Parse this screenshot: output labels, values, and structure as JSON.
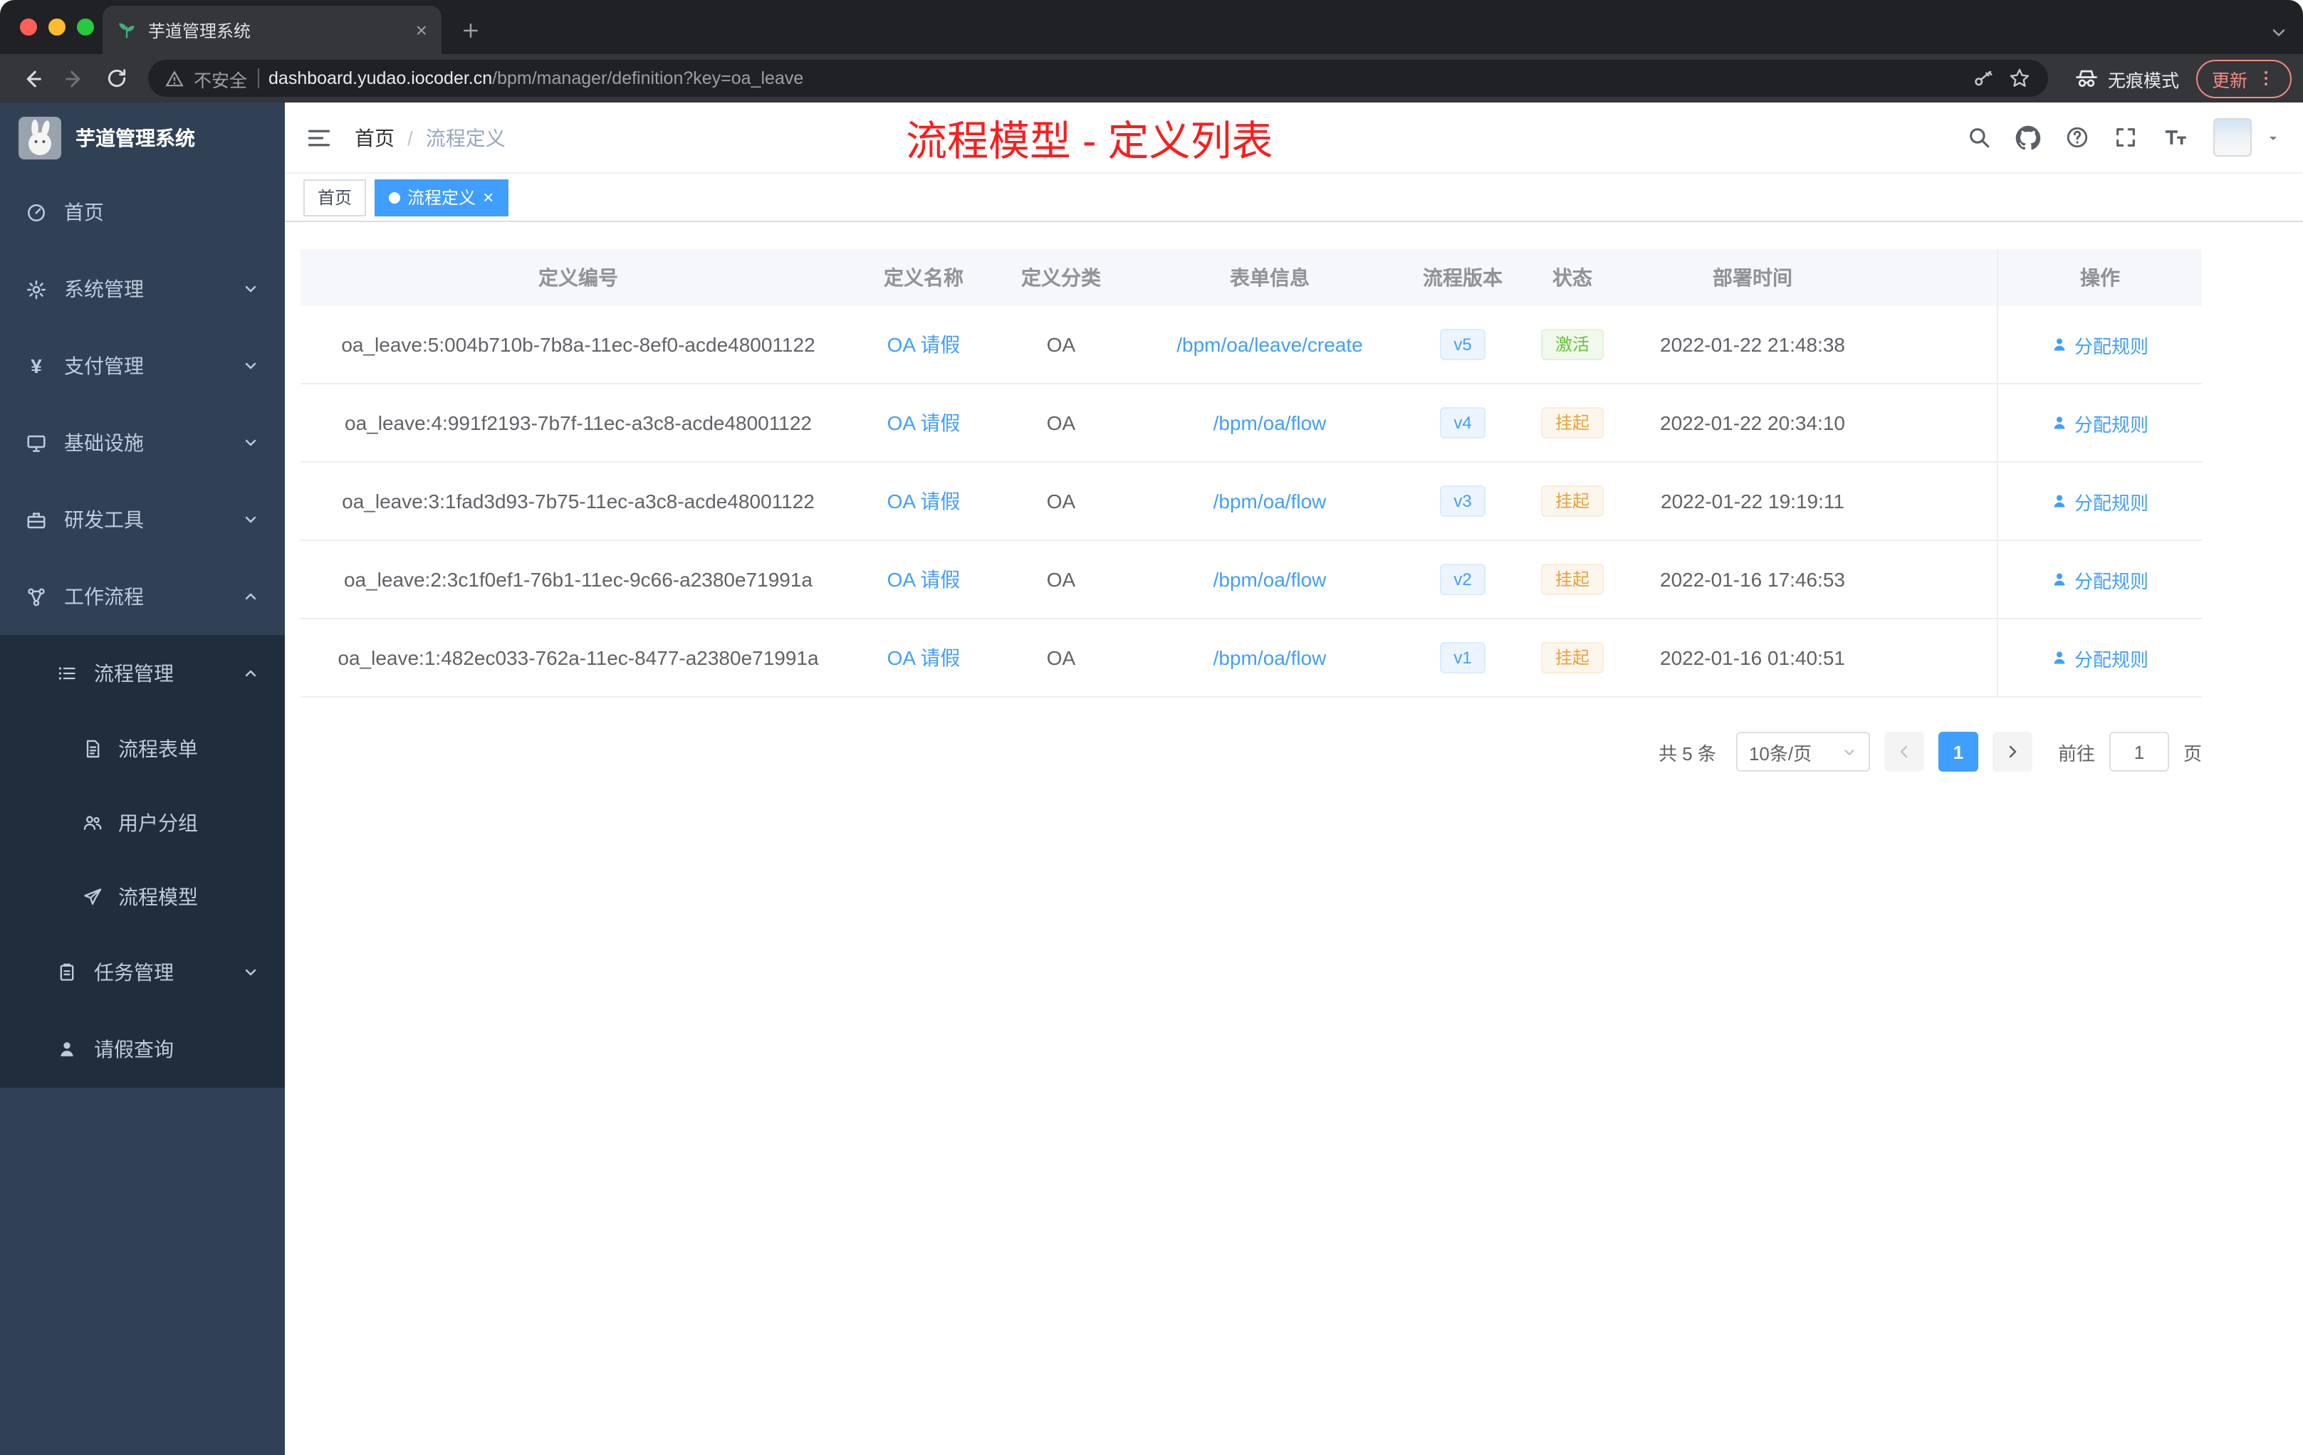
{
  "browser": {
    "tab_title": "芋道管理系统",
    "not_secure": "不安全",
    "url_host": "dashboard.yudao.iocoder.cn",
    "url_path": "/bpm/manager/definition?key=oa_leave",
    "incognito": "无痕模式",
    "update": "更新"
  },
  "sidebar": {
    "logo_title": "芋道管理系统",
    "items": [
      {
        "label": "首页"
      },
      {
        "label": "系统管理"
      },
      {
        "label": "支付管理"
      },
      {
        "label": "基础设施"
      },
      {
        "label": "研发工具"
      },
      {
        "label": "工作流程",
        "children": [
          {
            "label": "流程管理",
            "children": [
              {
                "label": "流程表单"
              },
              {
                "label": "用户分组"
              },
              {
                "label": "流程模型"
              }
            ]
          },
          {
            "label": "任务管理"
          },
          {
            "label": "请假查询"
          }
        ]
      }
    ]
  },
  "header": {
    "breadcrumb_home": "首页",
    "breadcrumb_sep": "/",
    "breadcrumb_current": "流程定义",
    "annotation": "流程模型 - 定义列表"
  },
  "tags": [
    {
      "label": "首页"
    },
    {
      "label": "流程定义"
    }
  ],
  "table": {
    "columns": [
      "定义编号",
      "定义名称",
      "定义分类",
      "表单信息",
      "流程版本",
      "状态",
      "部署时间",
      "操作"
    ],
    "rows": [
      {
        "id": "oa_leave:5:004b710b-7b8a-11ec-8ef0-acde48001122",
        "name": "OA 请假",
        "category": "OA",
        "form": "/bpm/oa/leave/create",
        "version": "v5",
        "status": "激活",
        "time": "2022-01-22 21:48:38",
        "action": "分配规则"
      },
      {
        "id": "oa_leave:4:991f2193-7b7f-11ec-a3c8-acde48001122",
        "name": "OA 请假",
        "category": "OA",
        "form": "/bpm/oa/flow",
        "version": "v4",
        "status": "挂起",
        "time": "2022-01-22 20:34:10",
        "action": "分配规则"
      },
      {
        "id": "oa_leave:3:1fad3d93-7b75-11ec-a3c8-acde48001122",
        "name": "OA 请假",
        "category": "OA",
        "form": "/bpm/oa/flow",
        "version": "v3",
        "status": "挂起",
        "time": "2022-01-22 19:19:11",
        "action": "分配规则"
      },
      {
        "id": "oa_leave:2:3c1f0ef1-76b1-11ec-9c66-a2380e71991a",
        "name": "OA 请假",
        "category": "OA",
        "form": "/bpm/oa/flow",
        "version": "v2",
        "status": "挂起",
        "time": "2022-01-16 17:46:53",
        "action": "分配规则"
      },
      {
        "id": "oa_leave:1:482ec033-762a-11ec-8477-a2380e71991a",
        "name": "OA 请假",
        "category": "OA",
        "form": "/bpm/oa/flow",
        "version": "v1",
        "status": "挂起",
        "time": "2022-01-16 01:40:51",
        "action": "分配规则"
      }
    ]
  },
  "pagination": {
    "total_label": "共 5 条",
    "page_size": "10条/页",
    "current_page": "1",
    "goto_label": "前往",
    "goto_value": "1",
    "page_unit": "页"
  },
  "colors": {
    "accent": "#409eff",
    "success": "#67c23a",
    "warning": "#e6a23c",
    "annotation_red": "#fb1d1d",
    "sidebar_bg": "#304156",
    "submenu_bg": "#1f2d3d"
  }
}
